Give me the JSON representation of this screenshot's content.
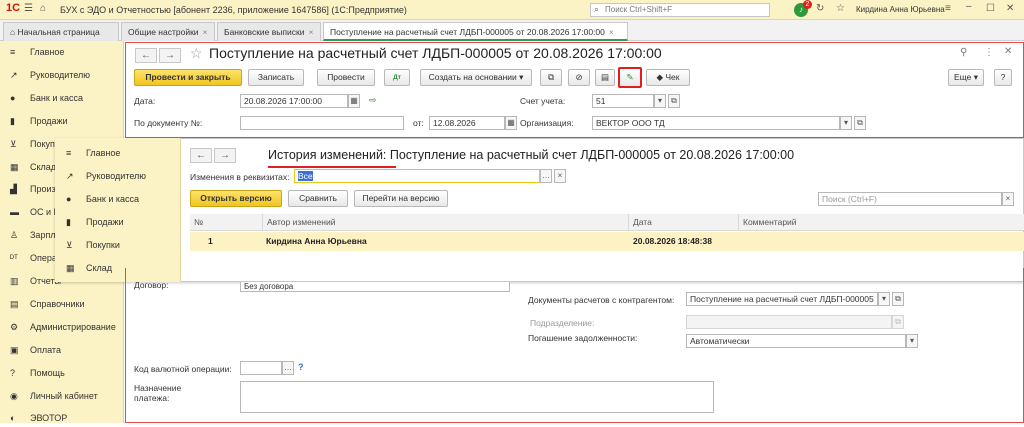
{
  "app": {
    "logo": "1С",
    "title": "БУХ с ЭДО и Отчетностью [абонент 2236, приложение 1647586]  (1С:Предприятие)",
    "search_placeholder": "Поиск Ctrl+Shift+F",
    "notifications_count": "2",
    "user": "Кирдина Анна Юрьевна"
  },
  "tabs": [
    {
      "label": "Начальная страница"
    },
    {
      "label": "Общие настройки"
    },
    {
      "label": "Банковские выписки"
    },
    {
      "label": "Поступление на расчетный счет ЛДБП-000005 от 20.08.2026 17:00:00"
    }
  ],
  "sidebar": [
    {
      "label": "Главное",
      "icon": "hamburger-icon"
    },
    {
      "label": "Руководителю",
      "icon": "trend-icon"
    },
    {
      "label": "Банк и касса",
      "icon": "coin-icon"
    },
    {
      "label": "Продажи",
      "icon": "bag-icon"
    },
    {
      "label": "Покупки",
      "icon": "cart-icon"
    },
    {
      "label": "Склад",
      "icon": "warehouse-icon"
    },
    {
      "label": "Производство",
      "icon": "factory-icon"
    },
    {
      "label": "ОС и НМА",
      "icon": "truck-icon"
    },
    {
      "label": "Зарплата и кадры",
      "icon": "person-icon"
    },
    {
      "label": "Операции",
      "icon": "dt-kt-icon"
    },
    {
      "label": "Отчеты",
      "icon": "chart-icon"
    },
    {
      "label": "Справочники",
      "icon": "book-icon"
    },
    {
      "label": "Администрирование",
      "icon": "gear-icon"
    },
    {
      "label": "Оплата",
      "icon": "wallet-icon"
    },
    {
      "label": "Помощь",
      "icon": "question-icon"
    },
    {
      "label": "Личный кабинет",
      "icon": "cabinet-icon"
    },
    {
      "label": "ЭВОТОР",
      "icon": "evotor-icon"
    }
  ],
  "doc": {
    "title": "Поступление на расчетный счет ЛДБП-000005 от 20.08.2026 17:00:00",
    "toolbar": {
      "post_close": "Провести и закрыть",
      "save": "Записать",
      "post": "Провести",
      "create_based": "Создать на основании",
      "check": "Чек",
      "more": "Еще"
    },
    "date_label": "Дата:",
    "date_value": "20.08.2026 17:00:00",
    "doc_no_label": "По документу №:",
    "from_label": "от:",
    "from_value": "12.08.2026",
    "account_label": "Счет учета:",
    "account_value": "51",
    "org_label": "Организация:",
    "org_value": "ВЕКТОР ООО ТД",
    "contract_label": "Договор:",
    "contract_value": "Без договора",
    "settle_docs_label": "Документы расчетов с контрагентом:",
    "settle_docs_value": "Поступление на расчетный счет ЛДБП-000005",
    "department_label": "Подразделение:",
    "repayment_label": "Погашение задолженности:",
    "repayment_value": "Автоматически",
    "currency_op_label": "Код валютной операции:",
    "currency_op_help": "?",
    "purpose_label": "Назначение платежа:"
  },
  "history": {
    "sidebar": [
      {
        "label": "Главное",
        "icon": "hamburger-icon"
      },
      {
        "label": "Руководителю",
        "icon": "trend-icon"
      },
      {
        "label": "Банк и касса",
        "icon": "coin-icon"
      },
      {
        "label": "Продажи",
        "icon": "bag-icon"
      },
      {
        "label": "Покупки",
        "icon": "cart-icon"
      },
      {
        "label": "Склад",
        "icon": "warehouse-icon"
      }
    ],
    "title": "История изменений: Поступление на расчетный счет ЛДБП-000005 от 20.08.2026 17:00:00",
    "filter_label": "Изменения в реквизитах:",
    "filter_value": "Все",
    "open_version": "Открыть версию",
    "compare": "Сравнить",
    "goto_version": "Перейти на версию",
    "search_placeholder": "Поиск (Ctrl+F)",
    "columns": [
      "№",
      "Автор изменений",
      "Дата",
      "Комментарий"
    ],
    "rows": [
      {
        "no": "1",
        "author": "Кирдина Анна Юрьевна",
        "date": "20.08.2026 18:48:38",
        "comment": ""
      }
    ]
  }
}
